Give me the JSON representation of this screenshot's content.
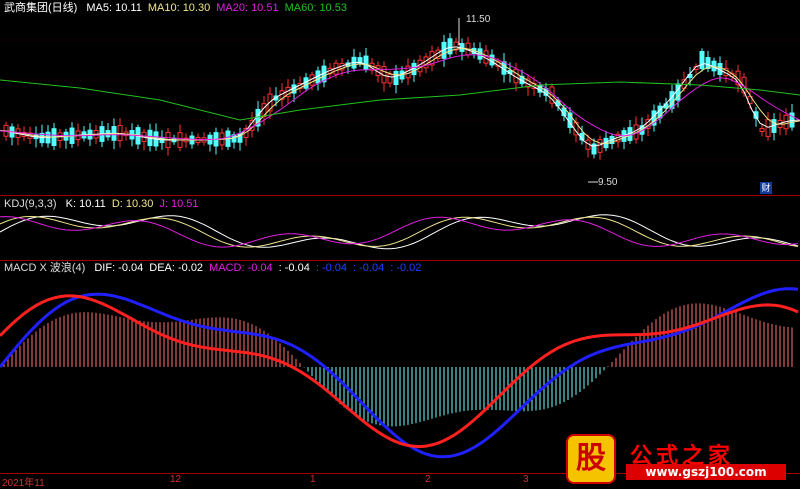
{
  "main_panel": {
    "title": "武商集团(日线)",
    "ma": [
      {
        "label": "MA5: 10.11",
        "color": "#ffffff"
      },
      {
        "label": "MA10: 10.30",
        "color": "#f0e68c"
      },
      {
        "label": "MA20: 10.51",
        "color": "#e020e0"
      },
      {
        "label": "MA60: 10.53",
        "color": "#20c020"
      }
    ],
    "high_label": "11.50",
    "low_label": "9.50",
    "cai_icon": "财"
  },
  "kdj_panel": {
    "title": "KDJ(9,3,3)",
    "items": [
      {
        "label": "K: 10.11",
        "color": "#ffffff"
      },
      {
        "label": "D: 10.30",
        "color": "#f0e68c"
      },
      {
        "label": "J: 10.51",
        "color": "#e020e0"
      }
    ]
  },
  "macd_panel": {
    "title": "MACD X 波浪(4)",
    "items": [
      {
        "label": "DIF: -0.04",
        "color": "#ffffff"
      },
      {
        "label": "DEA: -0.02",
        "color": "#ffffff"
      },
      {
        "label": "MACD: -0.04",
        "color": "#e020e0"
      },
      {
        "label": ": -0.04",
        "color": "#ffffff"
      },
      {
        "label": ": -0.04",
        "color": "#2040ff"
      },
      {
        "label": ": -0.04",
        "color": "#2040ff"
      },
      {
        "label": ": -0.02",
        "color": "#2040ff"
      }
    ]
  },
  "x_axis": {
    "labels": [
      "2021年11",
      "12",
      "1",
      "2",
      "3"
    ]
  },
  "watermark": {
    "badge": "股",
    "title": "公式之家",
    "url": "www.gszj100.com"
  },
  "colors": {
    "up": "#ff3232",
    "down": "#54ffff",
    "grid": "#a00000"
  }
}
